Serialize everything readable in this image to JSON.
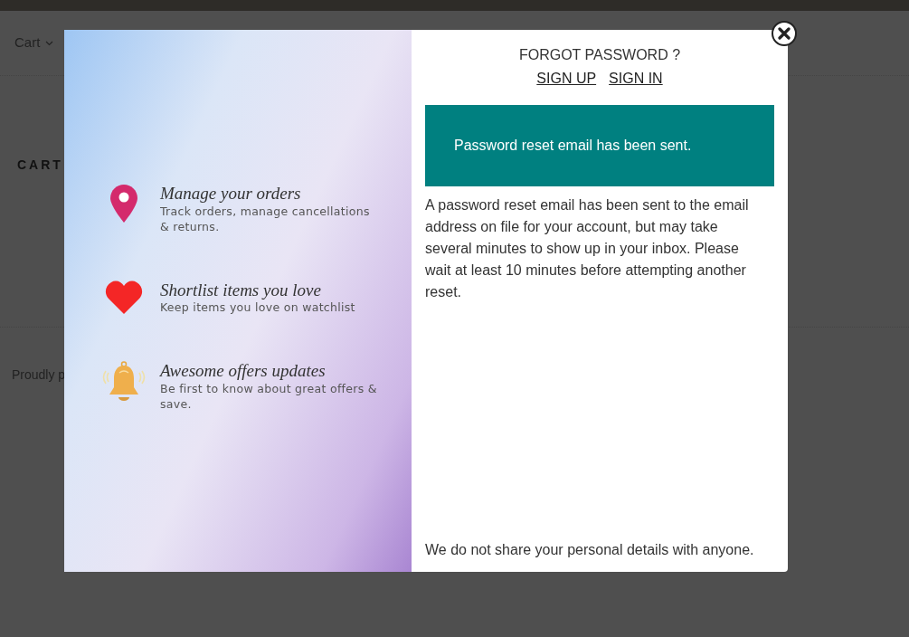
{
  "page": {
    "menu_item": "Cart",
    "heading": "CART",
    "footer_text": "Proudly p"
  },
  "modal": {
    "features": [
      {
        "kind": "pin",
        "title": "Manage your orders",
        "text": "Track orders, manage cancellations & returns."
      },
      {
        "kind": "heart",
        "title": "Shortlist items you love",
        "text": "Keep items you love on watchlist"
      },
      {
        "kind": "bell",
        "title": "Awesome offers updates",
        "text": "Be first to know about great offers & save."
      }
    ],
    "title": "FORGOT PASSWORD ?",
    "links": [
      "SIGN UP",
      "SIGN IN"
    ],
    "alert": "Password reset email has been sent.",
    "message": "A password reset email has been sent to the email address on file for your account, but may take several minutes to show up in your inbox. Please wait at least 10 minutes before attempting another reset.",
    "footnote": "We do not share your personal details with anyone."
  }
}
